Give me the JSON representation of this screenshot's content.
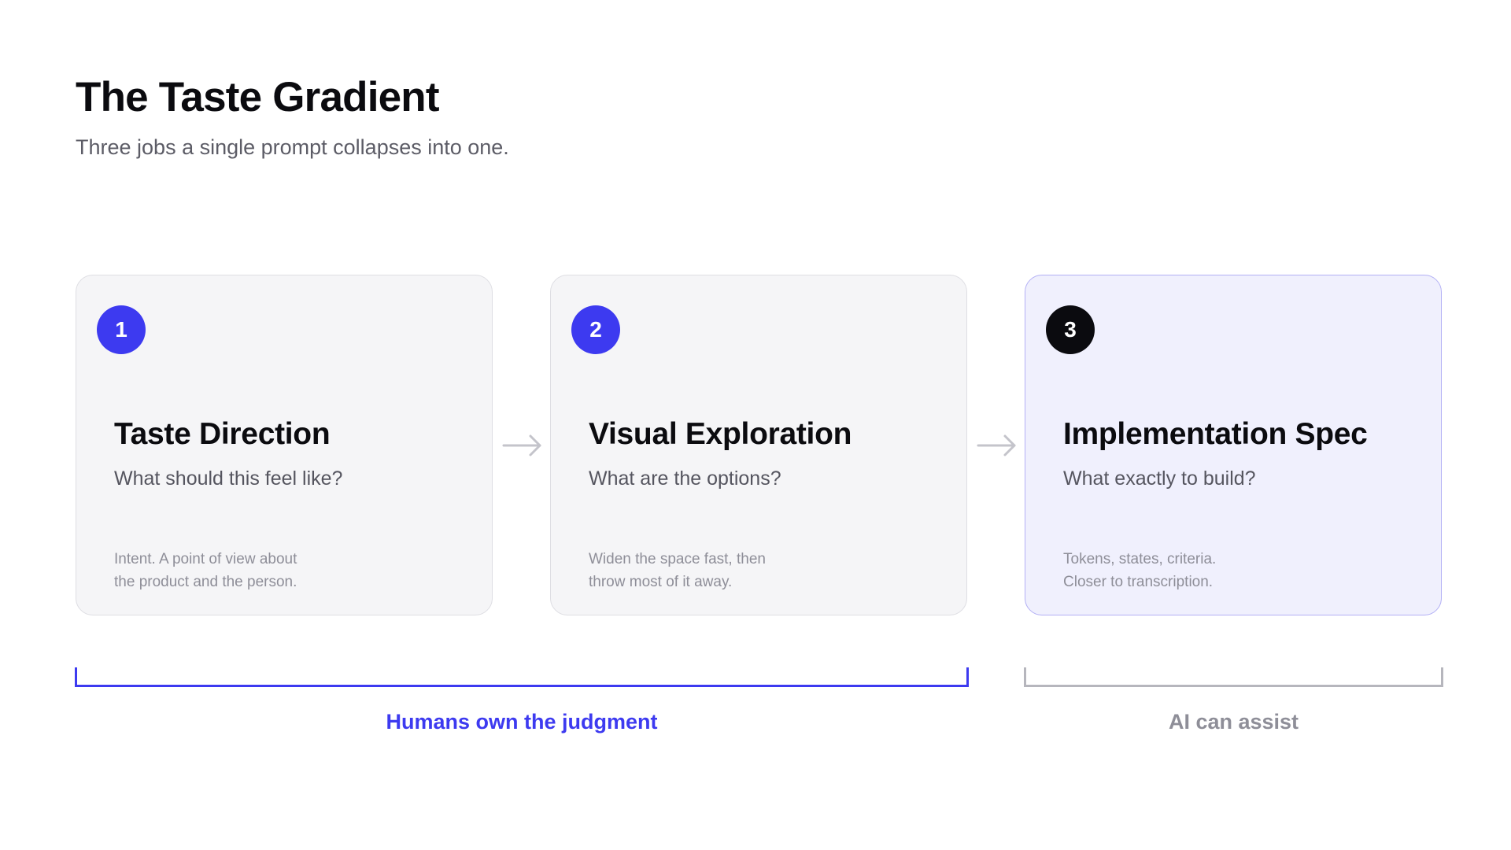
{
  "title": "The Taste Gradient",
  "subtitle": "Three jobs a single prompt collapses into one.",
  "cards": [
    {
      "number": "1",
      "badge_color": "#3d3af0",
      "title": "Taste Direction",
      "question": "What should this feel like?",
      "note_lines": [
        "Intent. A point of view about",
        "the product and the person."
      ]
    },
    {
      "number": "2",
      "badge_color": "#3d3af0",
      "title": "Visual Exploration",
      "question": "What are the options?",
      "note_lines": [
        "Widen the space fast, then",
        "throw most of it away."
      ]
    },
    {
      "number": "3",
      "badge_color": "#0b0b0f",
      "title": "Implementation Spec",
      "question": "What exactly to build?",
      "note_lines": [
        "Tokens, states, criteria.",
        "Closer to transcription."
      ],
      "highlighted": true
    }
  ],
  "groups": {
    "humans": {
      "label": "Humans own the judgment",
      "color": "#3d3af0",
      "spans_cards": [
        1,
        2
      ]
    },
    "ai": {
      "label": "AI can assist",
      "color": "#8e8e98",
      "spans_cards": [
        3
      ]
    }
  },
  "colors": {
    "accent": "#3d3af0",
    "card_background": "#f5f5f7",
    "highlight_background": "#f0f0fd",
    "highlight_border": "#b3b0f5",
    "arrow": "#c4c4cb"
  },
  "icons": {
    "connector": "arrow-right-icon"
  }
}
